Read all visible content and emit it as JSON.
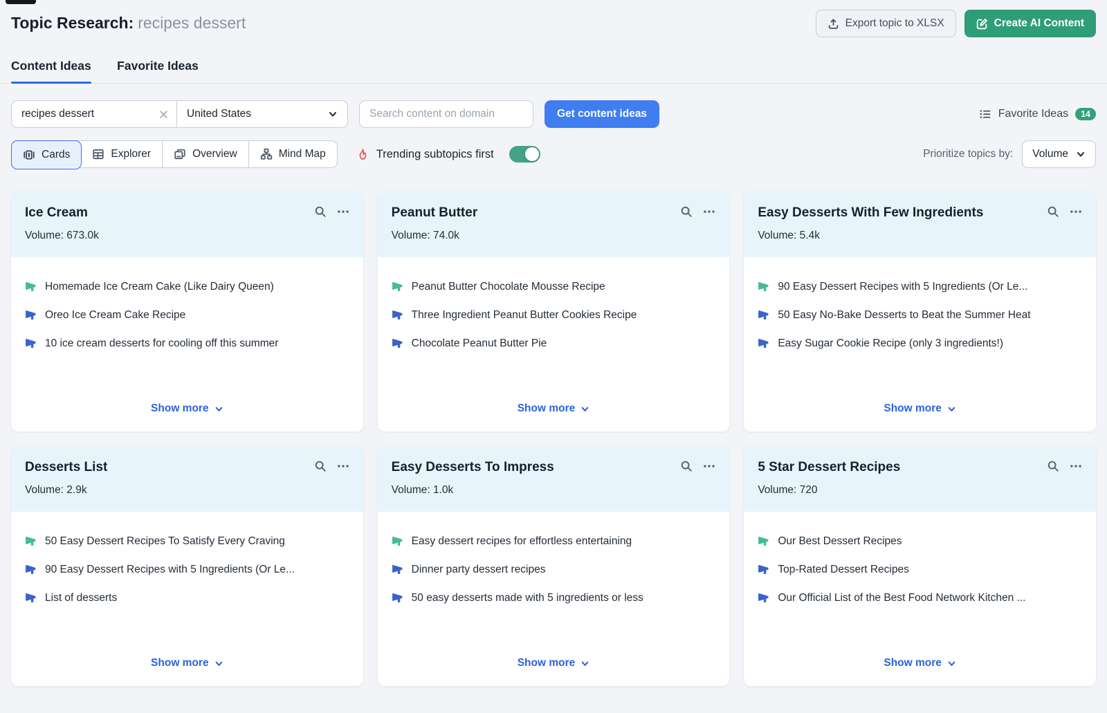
{
  "header": {
    "title": "Topic Research:",
    "query": "recipes dessert",
    "export_label": "Export topic to XLSX",
    "create_ai_label": "Create AI Content"
  },
  "tabs": {
    "content_ideas": "Content Ideas",
    "favorite_ideas": "Favorite Ideas",
    "active": "Content Ideas"
  },
  "search": {
    "query_value": "recipes dessert",
    "country_value": "United States",
    "domain_placeholder": "Search content on domain",
    "submit_label": "Get content ideas",
    "favorites_label": "Favorite Ideas",
    "favorites_count": "14"
  },
  "view_bar": {
    "views": {
      "cards": "Cards",
      "explorer": "Explorer",
      "overview": "Overview",
      "mindmap": "Mind Map"
    },
    "active_view": "Cards",
    "trending_label": "Trending subtopics first",
    "trending_on": true,
    "prioritize_label": "Prioritize topics by:",
    "prioritize_value": "Volume"
  },
  "cards": [
    {
      "title": "Ice Cream",
      "volume": "Volume: 673.0k",
      "show_more_label": "Show more",
      "items": [
        {
          "text": "Homemade Ice Cream Cake (Like Dairy Queen)",
          "trending": true
        },
        {
          "text": "Oreo Ice Cream Cake Recipe",
          "trending": false
        },
        {
          "text": "10 ice cream desserts for cooling off this summer",
          "trending": false
        }
      ]
    },
    {
      "title": "Peanut Butter",
      "volume": "Volume: 74.0k",
      "show_more_label": "Show more",
      "items": [
        {
          "text": "Peanut Butter Chocolate Mousse Recipe",
          "trending": true
        },
        {
          "text": "Three Ingredient Peanut Butter Cookies Recipe",
          "trending": false
        },
        {
          "text": "Chocolate Peanut Butter Pie",
          "trending": false
        }
      ]
    },
    {
      "title": "Easy Desserts With Few Ingredients",
      "volume": "Volume: 5.4k",
      "show_more_label": "Show more",
      "items": [
        {
          "text": "90 Easy Dessert Recipes with 5 Ingredients (Or Le...",
          "trending": true
        },
        {
          "text": "50 Easy No-Bake Desserts to Beat the Summer Heat",
          "trending": false
        },
        {
          "text": "Easy Sugar Cookie Recipe (only 3 ingredients!)",
          "trending": false
        }
      ]
    },
    {
      "title": "Desserts List",
      "volume": "Volume: 2.9k",
      "show_more_label": "Show more",
      "items": [
        {
          "text": "50 Easy Dessert Recipes To Satisfy Every Craving",
          "trending": true
        },
        {
          "text": "90 Easy Dessert Recipes with 5 Ingredients (Or Le...",
          "trending": false
        },
        {
          "text": "List of desserts",
          "trending": false
        }
      ]
    },
    {
      "title": "Easy Desserts To Impress",
      "volume": "Volume: 1.0k",
      "show_more_label": "Show more",
      "items": [
        {
          "text": "Easy dessert recipes for effortless entertaining",
          "trending": true
        },
        {
          "text": "Dinner party dessert recipes",
          "trending": false
        },
        {
          "text": "50 easy desserts made with 5 ingredients or less",
          "trending": false
        }
      ]
    },
    {
      "title": "5 Star Dessert Recipes",
      "volume": "Volume: 720",
      "show_more_label": "Show more",
      "items": [
        {
          "text": "Our Best Dessert Recipes",
          "trending": true
        },
        {
          "text": "Top-Rated Dessert Recipes",
          "trending": false
        },
        {
          "text": "Our Official List of the Best Food Network Kitchen ...",
          "trending": false
        }
      ]
    }
  ],
  "colors": {
    "page_background": "#f3f4f7",
    "card_header_background": "#e8f4fc",
    "accent_blue": "#3f7df0",
    "link_blue": "#2b63d9",
    "tab_underline_blue": "#2b6be4",
    "selected_segment_border": "#3b6ef5",
    "green_button": "#2f9d78",
    "toggle_green": "#43a384",
    "badge_green": "#33a077",
    "megaphone_green": "#47bd8e",
    "megaphone_blue": "#3a63cc",
    "flame_red": "#ec5b5b"
  }
}
